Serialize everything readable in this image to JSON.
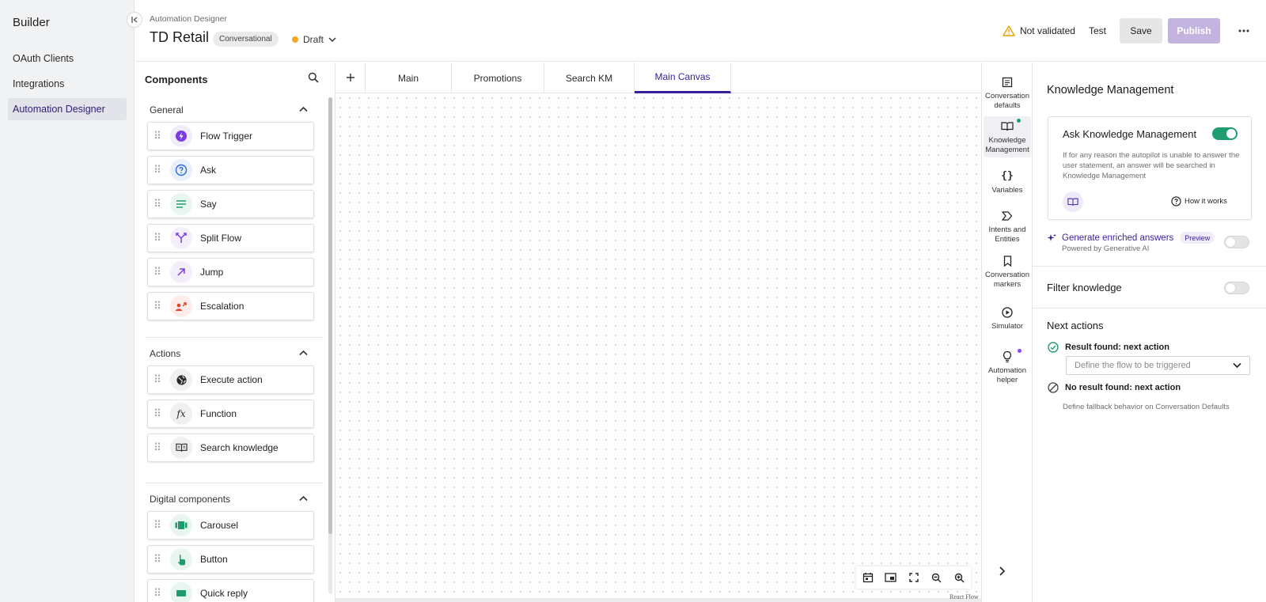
{
  "sidebar": {
    "brand": "Builder",
    "items": [
      {
        "label": "OAuth Clients"
      },
      {
        "label": "Integrations"
      },
      {
        "label": "Automation Designer"
      }
    ]
  },
  "header": {
    "breadcrumb": "Automation Designer",
    "title": "TD Retail",
    "type_chip": "Conversational",
    "status": "Draft",
    "validation": "Not validated",
    "test_label": "Test",
    "save_label": "Save",
    "publish_label": "Publish"
  },
  "components": {
    "title": "Components",
    "sections": [
      {
        "title": "General",
        "items": [
          {
            "label": "Flow Trigger",
            "icon": "bolt-icon"
          },
          {
            "label": "Ask",
            "icon": "question-icon"
          },
          {
            "label": "Say",
            "icon": "lines-icon"
          },
          {
            "label": "Split Flow",
            "icon": "split-icon"
          },
          {
            "label": "Jump",
            "icon": "arrow-up-right-icon"
          },
          {
            "label": "Escalation",
            "icon": "escalation-icon"
          }
        ]
      },
      {
        "title": "Actions",
        "items": [
          {
            "label": "Execute action",
            "icon": "globe-icon"
          },
          {
            "label": "Function",
            "icon": "fx-icon"
          },
          {
            "label": "Search knowledge",
            "icon": "book-icon"
          }
        ]
      },
      {
        "title": "Digital components",
        "items": [
          {
            "label": "Carousel",
            "icon": "carousel-icon"
          },
          {
            "label": "Button",
            "icon": "pointer-icon"
          },
          {
            "label": "Quick reply",
            "icon": "quick-reply-icon"
          }
        ]
      }
    ]
  },
  "tabs": [
    {
      "label": "Main"
    },
    {
      "label": "Promotions"
    },
    {
      "label": "Search KM"
    },
    {
      "label": "Main Canvas"
    }
  ],
  "canvas": {
    "attribution": "React Flow"
  },
  "rail": [
    {
      "label": "Conversation defaults"
    },
    {
      "label": "Knowledge Management"
    },
    {
      "label": "Variables"
    },
    {
      "label": "Intents and Entities"
    },
    {
      "label": "Conversation markers"
    },
    {
      "label": "Simulator"
    },
    {
      "label": "Automation helper"
    }
  ],
  "panel": {
    "title": "Knowledge Management",
    "ask_km_title": "Ask Knowledge Management",
    "ask_km_enabled": true,
    "ask_km_desc": "If for any reason the autopilot is unable to answer the user statement, an answer will be searched in Knowledge Management",
    "how_it_works": "How it works",
    "generate_title": "Generate enriched answers",
    "generate_badge": "Preview",
    "generate_sub": "Powered by Generative AI",
    "generate_enabled": false,
    "filter_title": "Filter knowledge",
    "filter_enabled": false,
    "next_actions_title": "Next actions",
    "result_found": "Result found: next action",
    "flow_placeholder": "Define the flow to be triggered",
    "no_result": "No result found: next action",
    "no_result_sub": "Define fallback behavior on Conversation Defaults"
  },
  "colors": {
    "accent": "#3a1f9a",
    "toggle_on": "#1f9e6d",
    "publish_disabled": "#c3b4df",
    "draft_dot": "#f5a623"
  }
}
